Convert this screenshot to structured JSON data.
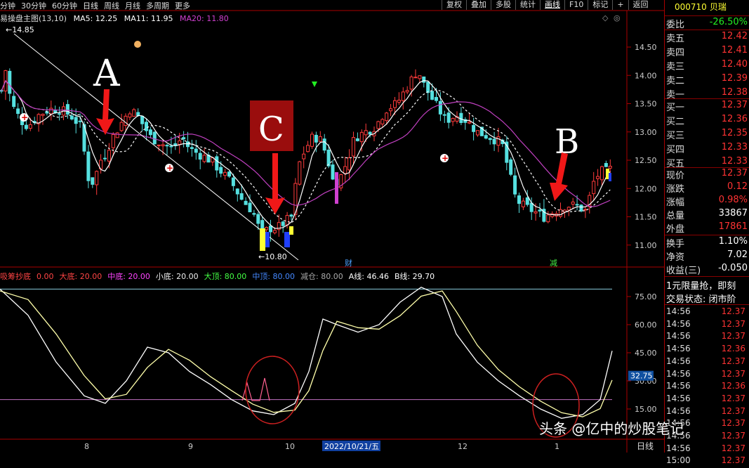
{
  "period_bar": [
    "分钟",
    "30分钟",
    "60分钟",
    "日线",
    "周线",
    "月线",
    "多周期",
    "更多"
  ],
  "toolbar": [
    "复权",
    "叠加",
    "多股",
    "统计",
    "画线",
    "F10",
    "标记",
    "+",
    "返回"
  ],
  "main_title": "易操盘主图(13,10)",
  "ma": {
    "ma5_label": "MA5: 12.25",
    "ma11_label": "MA11: 11.95",
    "ma20_label": "MA20: 11.80"
  },
  "price_axis": [
    "14.50",
    "14.00",
    "13.50",
    "13.00",
    "12.50",
    "12.00",
    "11.50",
    "11.00"
  ],
  "high_label": "14.85",
  "low_label": "10.80",
  "annotations": {
    "a": "A",
    "b": "B",
    "c": "C",
    "cai": "财",
    "jian": "减"
  },
  "indicator": {
    "name": "吸筹抄底",
    "name_val": "0.00",
    "items": [
      {
        "label": "大底: 20.00",
        "color": "#ff4444"
      },
      {
        "label": "中底: 20.00",
        "color": "#ff44ff"
      },
      {
        "label": "小底: 20.00",
        "color": "#eeeeee"
      },
      {
        "label": "大顶: 80.00",
        "color": "#44ff44"
      },
      {
        "label": "中顶: 80.00",
        "color": "#4488ff"
      },
      {
        "label": "减仓: 80.00",
        "color": "#aaaaaa"
      },
      {
        "label": "A线: 46.46",
        "color": "#ffffff"
      },
      {
        "label": "B线: 29.70",
        "color": "#ffffff"
      }
    ]
  },
  "ind_axis": [
    "75.00",
    "60.00",
    "45.00",
    "30.00",
    "15.00"
  ],
  "current_ind": "32.75",
  "date_axis": [
    "8",
    "9",
    "10",
    "2022/10/21/五",
    "12",
    "1"
  ],
  "quote": {
    "code": "000710",
    "name": "贝瑞",
    "weibi_label": "委比",
    "weibi": "-26.50%",
    "sell": [
      [
        "卖五",
        "12.42"
      ],
      [
        "卖四",
        "12.41"
      ],
      [
        "卖三",
        "12.40"
      ],
      [
        "卖二",
        "12.39"
      ],
      [
        "卖一",
        "12.38"
      ]
    ],
    "buy": [
      [
        "买一",
        "12.37"
      ],
      [
        "买二",
        "12.36"
      ],
      [
        "买三",
        "12.35"
      ],
      [
        "买四",
        "12.33"
      ],
      [
        "买五",
        "12.33"
      ]
    ],
    "stats": [
      [
        "现价",
        "12.37",
        "red"
      ],
      [
        "涨跌",
        "0.12",
        "red"
      ],
      [
        "涨幅",
        "0.98%",
        "red"
      ],
      [
        "总量",
        "33867",
        "wht"
      ],
      [
        "外盘",
        "17861",
        "red"
      ]
    ],
    "stats2": [
      [
        "换手",
        "1.10%"
      ],
      [
        "净资",
        "7.02"
      ],
      [
        "收益(三)",
        "-0.050"
      ]
    ],
    "notice": "1元限量抢，即刻",
    "trade_status": "交易状态: 闭市阶",
    "ticks": [
      [
        "14:56",
        "12.37"
      ],
      [
        "14:56",
        "12.37"
      ],
      [
        "14:56",
        "12.37"
      ],
      [
        "14:56",
        "12.36"
      ],
      [
        "14:56",
        "12.37"
      ],
      [
        "14:56",
        "12.37"
      ],
      [
        "14:56",
        "12.36"
      ],
      [
        "14:56",
        "12.37"
      ],
      [
        "14:56",
        "12.37"
      ],
      [
        "14:56",
        "12.37"
      ],
      [
        "14:56",
        "12.37"
      ],
      [
        "14:56",
        "12.37"
      ],
      [
        "15:00",
        "12.37"
      ]
    ]
  },
  "watermark": "头条 @亿中的炒股笔记",
  "bottom_label": "日线",
  "colors": {
    "up": "#ff3b3b",
    "down": "#55e0e0",
    "ma20": "#c040c0",
    "ma_white": "#ffffff",
    "ind_line": "#ffffaa"
  }
}
